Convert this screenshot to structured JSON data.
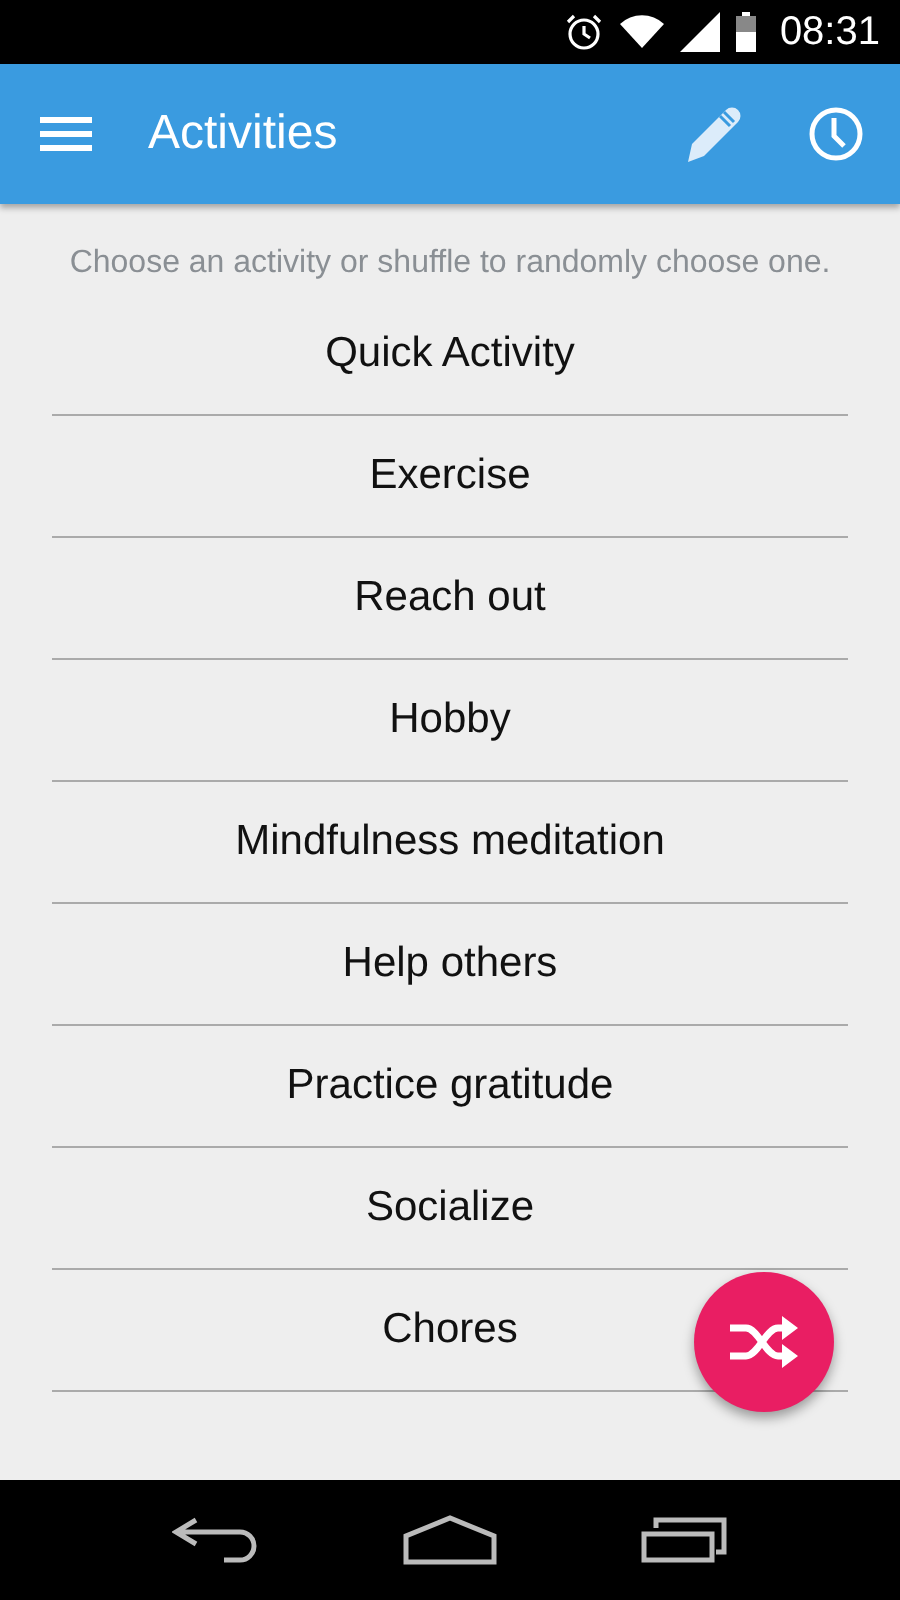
{
  "status_bar": {
    "time": "08:31"
  },
  "app_bar": {
    "title": "Activities"
  },
  "hint": "Choose an activity or shuffle to randomly choose one.",
  "activities": [
    "Quick Activity",
    "Exercise",
    "Reach out",
    "Hobby",
    "Mindfulness meditation",
    "Help others",
    "Practice gratitude",
    "Socialize",
    "Chores"
  ]
}
